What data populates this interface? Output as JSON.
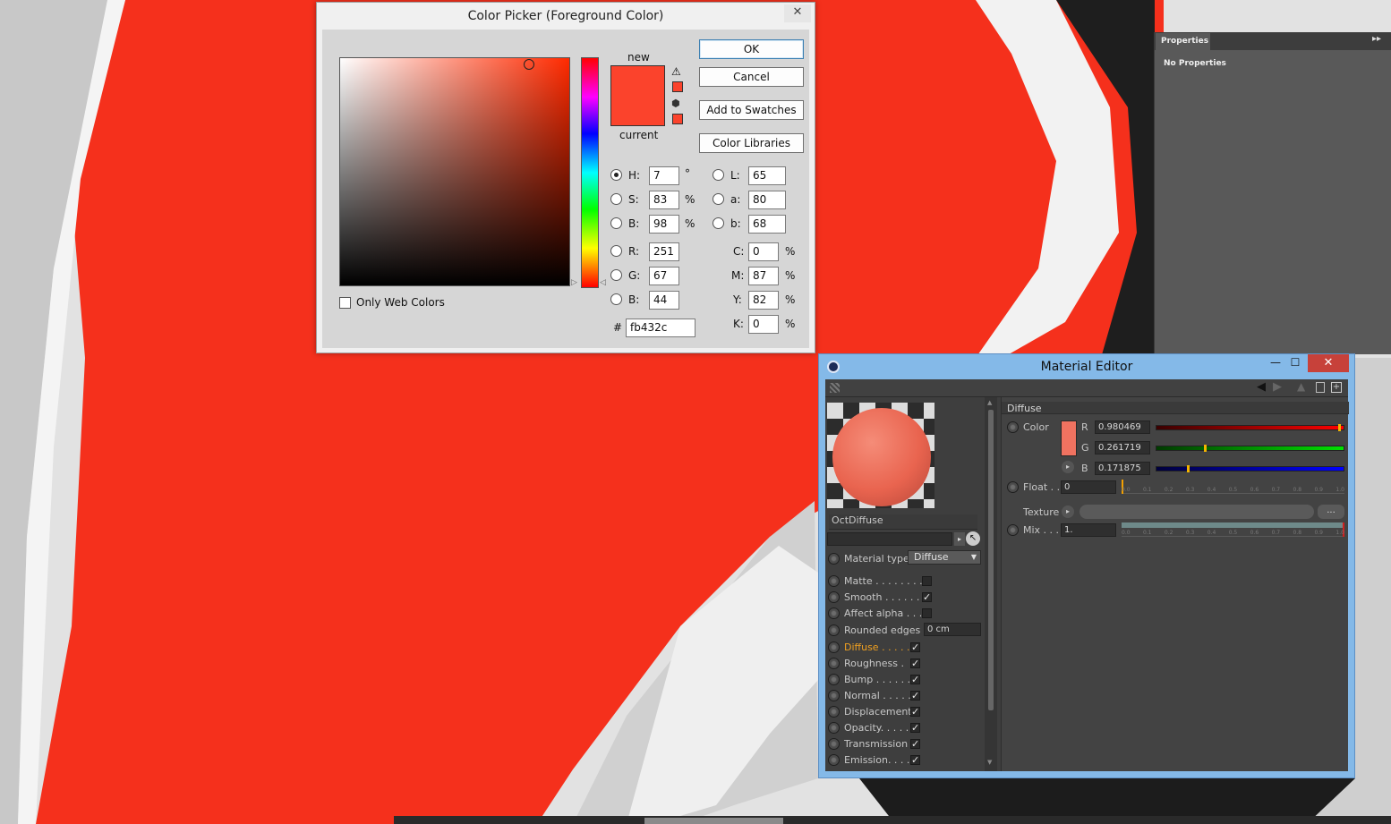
{
  "color_picker": {
    "title": "Color Picker (Foreground Color)",
    "close_glyph": "✕",
    "buttons": {
      "ok": "OK",
      "cancel": "Cancel",
      "add_swatches": "Add to Swatches",
      "color_libraries": "Color Libraries"
    },
    "new_label": "new",
    "current_label": "current",
    "new_color": "#fb432c",
    "current_color": "#fb432c",
    "warning_icons": [
      "gamut-warning-icon",
      "web-cube-icon"
    ],
    "fields": {
      "H": {
        "label": "H:",
        "value": "7",
        "unit": "°"
      },
      "S": {
        "label": "S:",
        "value": "83",
        "unit": "%"
      },
      "Bv": {
        "label": "B:",
        "value": "98",
        "unit": "%"
      },
      "R": {
        "label": "R:",
        "value": "251"
      },
      "G": {
        "label": "G:",
        "value": "67"
      },
      "Bc": {
        "label": "B:",
        "value": "44"
      },
      "L": {
        "label": "L:",
        "value": "65"
      },
      "a": {
        "label": "a:",
        "value": "80"
      },
      "b": {
        "label": "b:",
        "value": "68"
      },
      "C": {
        "label": "C:",
        "value": "0",
        "unit": "%"
      },
      "M": {
        "label": "M:",
        "value": "87",
        "unit": "%"
      },
      "Y": {
        "label": "Y:",
        "value": "82",
        "unit": "%"
      },
      "K": {
        "label": "K:",
        "value": "0",
        "unit": "%"
      }
    },
    "hex_label": "#",
    "hex_value": "fb432c",
    "only_web_colors": "Only Web Colors"
  },
  "properties_panel": {
    "tab": "Properties",
    "menu_glyph": "▸▸",
    "message": "No Properties"
  },
  "material_editor": {
    "title": "Material Editor",
    "window_buttons": {
      "minimize": "—",
      "maximize": "☐",
      "close": "✕"
    },
    "material_name": "OctDiffuse",
    "preview_color": "#f07260",
    "material_type_label": "Material type",
    "material_type_value": "Diffuse",
    "options": [
      {
        "label": "Matte . . . . . . . .",
        "checked": ""
      },
      {
        "label": "Smooth . . . . . .",
        "checked": "✓"
      },
      {
        "label": "Affect alpha . . .",
        "checked": ""
      }
    ],
    "rounded_edges_label": "Rounded edges",
    "rounded_edges_value": "0 cm",
    "channels": [
      {
        "label": "Diffuse . . . . .",
        "checked": "✓",
        "active": true
      },
      {
        "label": "Roughness .",
        "checked": "✓"
      },
      {
        "label": "Bump . . . . . .",
        "checked": "✓"
      },
      {
        "label": "Normal . . . . .",
        "checked": "✓"
      },
      {
        "label": "Displacement",
        "checked": "✓"
      },
      {
        "label": "Opacity. . . . .",
        "checked": "✓"
      },
      {
        "label": "Transmission",
        "checked": "✓"
      },
      {
        "label": "Emission. . . .",
        "checked": "✓"
      }
    ],
    "diffuse": {
      "section_title": "Diffuse",
      "color_label": "Color",
      "swatch_color": "#f07260",
      "R": {
        "label": "R",
        "value": "0.980469",
        "fraction": 0.980469
      },
      "G": {
        "label": "G",
        "value": "0.261719",
        "fraction": 0.261719
      },
      "B": {
        "label": "B",
        "value": "0.171875",
        "fraction": 0.171875
      },
      "float_label": "Float . .",
      "float_value": "0",
      "texture_label": "Texture",
      "texture_button": "...",
      "mix_label": "Mix . . .",
      "mix_value": "1.",
      "ticks": [
        "0.0",
        "0.1",
        "0.2",
        "0.3",
        "0.4",
        "0.5",
        "0.6",
        "0.7",
        "0.8",
        "0.9",
        "1.0"
      ]
    }
  }
}
